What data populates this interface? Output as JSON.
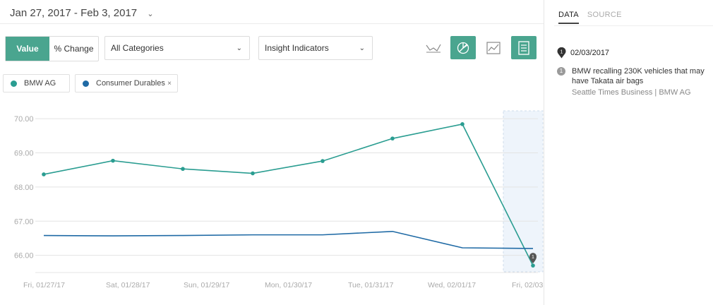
{
  "header": {
    "date_range": "Jan 27, 2017 - Feb 3, 2017"
  },
  "toolbar": {
    "toggle_value": "Value",
    "toggle_change": "% Change",
    "category_select": "All Categories",
    "insight_select": "Insight Indicators",
    "icons": [
      "line-chart-icon",
      "compare-icon",
      "area-chart-icon",
      "table-icon"
    ],
    "accent": "#4aa58f"
  },
  "legend": [
    {
      "name": "BMW AG",
      "color": "#2a9d91",
      "removable": false
    },
    {
      "name": "Consumer Durables",
      "color": "#1f6aa5",
      "removable": true,
      "remove_label": "×"
    }
  ],
  "right_panel": {
    "tabs": [
      "DATA",
      "SOURCE"
    ],
    "active_tab": "DATA",
    "event_date": "02/03/2017",
    "event_pin": "1",
    "events": [
      {
        "badge": "1",
        "text": "BMW recalling 230K vehicles that may have Takata air bags",
        "source": "Seattle Times Business",
        "separator": "|",
        "entity": "BMW AG"
      }
    ]
  },
  "chart_data": {
    "type": "line",
    "categories": [
      "Fri, 01/27/17",
      "Sat, 01/28/17",
      "Sun, 01/29/17",
      "Mon, 01/30/17",
      "Tue, 01/31/17",
      "Wed, 02/01/17",
      "Fri, 02/03"
    ],
    "x": [
      "2017-01-27",
      "2017-01-28",
      "2017-01-29",
      "2017-01-30",
      "2017-01-31",
      "2017-02-01",
      "2017-02-03"
    ],
    "yticks": [
      "70.00",
      "69.00",
      "68.00",
      "67.00",
      "66.00"
    ],
    "ylim": [
      65.6,
      70.25
    ],
    "series": [
      {
        "name": "BMW AG",
        "color": "#2a9d91",
        "markers": true,
        "values": [
          68.37,
          68.77,
          68.53,
          68.4,
          68.76,
          69.42,
          69.84,
          65.7
        ]
      },
      {
        "name": "Consumer Durables",
        "color": "#1f6aa5",
        "markers": false,
        "values": [
          66.58,
          66.57,
          66.58,
          66.6,
          66.6,
          66.7,
          66.22,
          66.2
        ]
      }
    ],
    "highlight": {
      "from": "2017-02-03",
      "event": "1"
    },
    "grid": true
  }
}
